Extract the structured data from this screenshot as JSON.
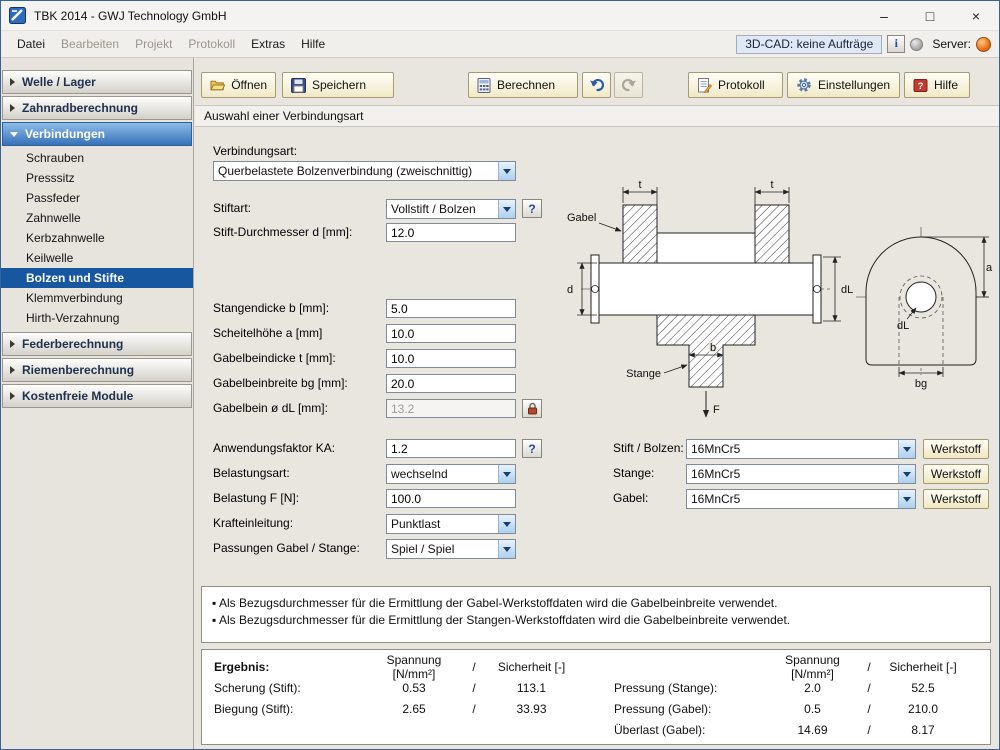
{
  "window": {
    "title": "TBK 2014 - GWJ Technology GmbH"
  },
  "titlebar": {
    "minimize": "–",
    "maximize": "□",
    "close": "×"
  },
  "menubar": {
    "items": [
      {
        "label": "Datei"
      },
      {
        "label": "Bearbeiten"
      },
      {
        "label": "Projekt"
      },
      {
        "label": "Protokoll"
      },
      {
        "label": "Extras"
      },
      {
        "label": "Hilfe"
      }
    ],
    "cad_status": "3D-CAD: keine Aufträge",
    "info_button": "i",
    "server_label": "Server:"
  },
  "sidebar": {
    "sections": [
      {
        "label": "Welle / Lager"
      },
      {
        "label": "Zahnradberechnung"
      },
      {
        "label": "Verbindungen"
      },
      {
        "label": "Federberechnung"
      },
      {
        "label": "Riemenberechnung"
      },
      {
        "label": "Kostenfreie Module"
      }
    ],
    "verbindungen_items": [
      "Schrauben",
      "Presssitz",
      "Passfeder",
      "Zahnwelle",
      "Kerbzahnwelle",
      "Keilwelle",
      "Bolzen und Stifte",
      "Klemmverbindung",
      "Hirth-Verzahnung"
    ],
    "selected_item": "Bolzen und Stifte"
  },
  "toolbar": {
    "open": "Öffnen",
    "save": "Speichern",
    "calculate": "Berechnen",
    "protocol": "Protokoll",
    "settings": "Einstellungen",
    "help": "Hilfe"
  },
  "page": {
    "subtitle": "Auswahl einer Verbindungsart"
  },
  "icons": {
    "question": "?"
  },
  "form": {
    "verbindungsart_label": "Verbindungsart:",
    "verbindungsart_value": "Querbelastete Bolzenverbindung (zweischnittig)",
    "stiftart_label": "Stiftart:",
    "stiftart_value": "Vollstift / Bolzen",
    "stift_durchmesser_label": "Stift-Durchmesser d [mm]:",
    "stift_durchmesser_value": "12.0",
    "stangendicke_label": "Stangendicke b [mm]:",
    "stangendicke_value": "5.0",
    "scheitelhoehe_label": "Scheitelhöhe a [mm]",
    "scheitelhoehe_value": "10.0",
    "gabelbeindicke_label": "Gabelbeindicke t [mm]:",
    "gabelbeindicke_value": "10.0",
    "gabelbeinbreite_label": "Gabelbeinbreite bg [mm]:",
    "gabelbeinbreite_value": "20.0",
    "gabelbein_dl_label": "Gabelbein ø dL [mm]:",
    "gabelbein_dl_value": "13.2",
    "anwendungsfaktor_label": "Anwendungsfaktor KA:",
    "anwendungsfaktor_value": "1.2",
    "belastungsart_label": "Belastungsart:",
    "belastungsart_value": "wechselnd",
    "belastung_label": "Belastung F [N]:",
    "belastung_value": "100.0",
    "krafteinleitung_label": "Krafteinleitung:",
    "krafteinleitung_value": "Punktlast",
    "passungen_label": "Passungen Gabel / Stange:",
    "passungen_value": "Spiel / Spiel"
  },
  "materials": {
    "stift_label": "Stift / Bolzen:",
    "stift_value": "16MnCr5",
    "stange_label": "Stange:",
    "stange_value": "16MnCr5",
    "gabel_label": "Gabel:",
    "gabel_value": "16MnCr5",
    "werkstoff_button": "Werkstoff"
  },
  "drawing": {
    "gabel": "Gabel",
    "stange": "Stange",
    "t": "t",
    "d": "d",
    "dl": "dL",
    "a": "a",
    "b": "b",
    "bg": "bg",
    "f": "F"
  },
  "notes": {
    "bullet": "▪",
    "lines": [
      "Als Bezugsdurchmesser für die Ermittlung der Gabel-Werkstoffdaten wird die Gabelbeinbreite verwendet.",
      "Als Bezugsdurchmesser für die Ermittlung der Stangen-Werkstoffdaten wird die Gabelbeinbreite verwendet."
    ]
  },
  "results": {
    "title": "Ergebnis:",
    "col_spannung": "Spannung [N/mm²]",
    "slash": "/",
    "col_sicherheit": "Sicherheit [-]",
    "left_rows": [
      {
        "label": "Scherung (Stift):",
        "spannung": "0.53",
        "sicherheit": "113.1"
      },
      {
        "label": "Biegung (Stift):",
        "spannung": "2.65",
        "sicherheit": "33.93"
      }
    ],
    "right_rows": [
      {
        "label": "Pressung (Stange):",
        "spannung": "2.0",
        "sicherheit": "52.5"
      },
      {
        "label": "Pressung (Gabel):",
        "spannung": "0.5",
        "sicherheit": "210.0"
      },
      {
        "label": "Überlast (Gabel):",
        "spannung": "14.69",
        "sicherheit": "8.17"
      }
    ]
  }
}
